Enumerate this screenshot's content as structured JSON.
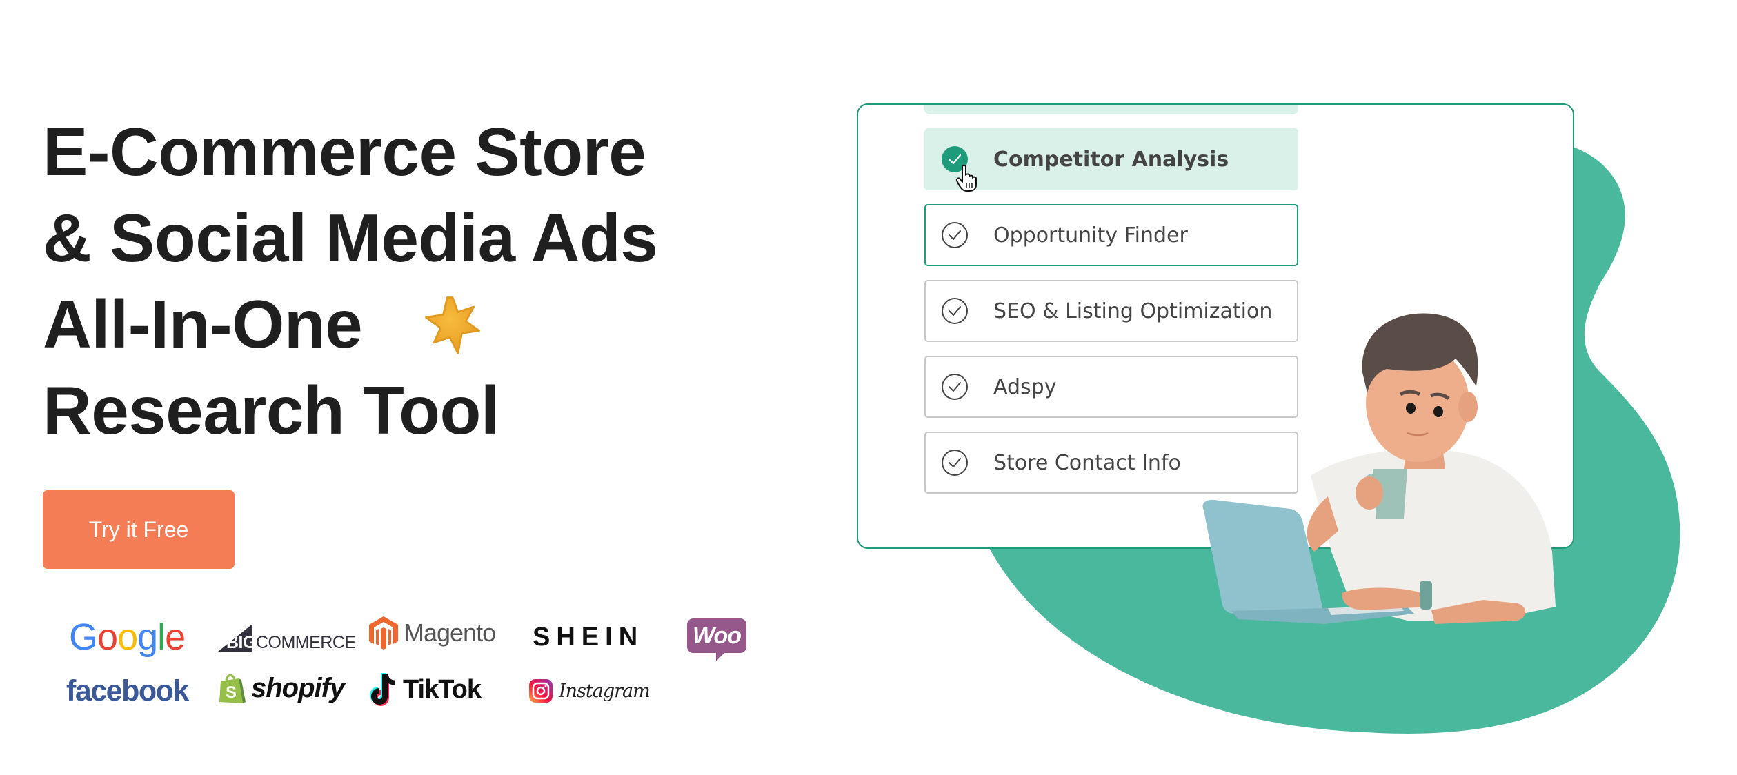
{
  "hero": {
    "title_lines": [
      "E-Commerce Store",
      "& Social Media Ads",
      "All-In-One",
      "Research Tool"
    ],
    "decoration_icon": "sparkle-star-icon",
    "cta_label": "Try it Free"
  },
  "logos": {
    "google": "Google",
    "bigcommerce_big": "BIG",
    "bigcommerce_rest": "COMMERCE",
    "magento": "Magento",
    "shein": "SHEIN",
    "woo": "Woo",
    "facebook": "facebook",
    "shopify": "shopify",
    "tiktok": "TikTok",
    "instagram": "Instagram"
  },
  "features": {
    "items": [
      {
        "label": "Competitor Analysis",
        "state": "selected"
      },
      {
        "label": "Opportunity Finder",
        "state": "focused"
      },
      {
        "label": "SEO & Listing Optimization",
        "state": "default"
      },
      {
        "label": "Adspy",
        "state": "default"
      },
      {
        "label": "Store Contact Info",
        "state": "default"
      }
    ]
  },
  "colors": {
    "accent": "#1e9b7b",
    "blob": "#4ab89d",
    "selected_bg": "#daf1ea",
    "cta": "#f57d55",
    "heading": "#1f1f1f"
  }
}
